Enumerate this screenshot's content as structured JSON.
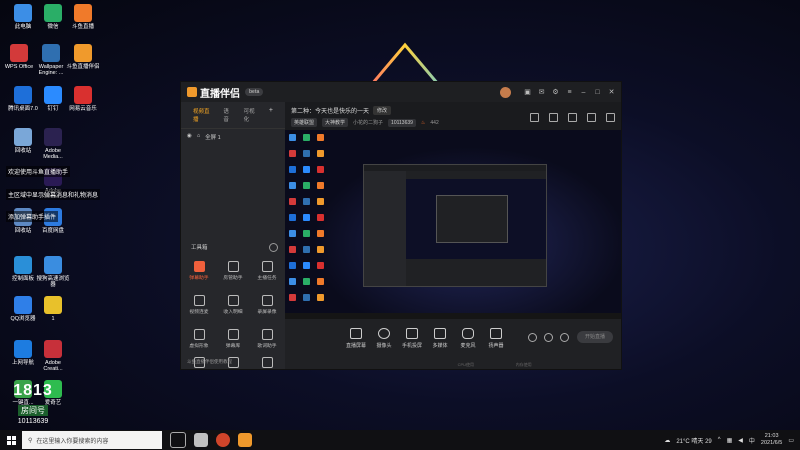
{
  "desktop": {
    "icons": [
      {
        "label": "此电脑",
        "color": "#3c8ee6"
      },
      {
        "label": "微信",
        "color": "#2aae67"
      },
      {
        "label": "斗鱼直播",
        "color": "#f07a2a"
      },
      {
        "label": "WPS Office",
        "color": "#d33a3a"
      },
      {
        "label": "Wallpaper Engine: ...",
        "color": "#2f6fb0"
      },
      {
        "label": "斗鱼直播伴侣",
        "color": "#f09a2c"
      },
      {
        "label": "腾讯桌面7.0",
        "color": "#1e6fd9"
      },
      {
        "label": "钉钉",
        "color": "#2b8bff"
      },
      {
        "label": "网易云音乐",
        "color": "#d9302f"
      },
      {
        "label": "回收站",
        "color": "#7aa7d8"
      },
      {
        "label": "Adobe Media...",
        "color": "#2b2250"
      },
      {
        "label": "Adobe Premie...",
        "color": "#2a1a55"
      },
      {
        "label": "回收站",
        "color": "#5d89c4"
      },
      {
        "label": "百度网盘",
        "color": "#2d7be0"
      },
      {
        "label": "控制面板",
        "color": "#2a8fd8"
      },
      {
        "label": "搜狗高速浏览器",
        "color": "#3a8de0"
      },
      {
        "label": "QQ浏览器",
        "color": "#2f7fe8"
      },
      {
        "label": "1",
        "color": "#e8c12b"
      },
      {
        "label": "上网导航",
        "color": "#1d7ce0"
      },
      {
        "label": "Adobe Creati...",
        "color": "#c7303a"
      },
      {
        "label": "一键直...",
        "color": "#3aa34a"
      },
      {
        "label": "爱奇艺",
        "color": "#2ebc4f"
      }
    ],
    "overlay_lines": [
      "欢迎使用斗鱼直播助手",
      "主区域中显示弹幕消息和礼物消息",
      "添加弹幕助手插件"
    ],
    "room_badge": {
      "big": "1813",
      "title": "房间号",
      "number": "10113639"
    }
  },
  "app": {
    "name": "直播伴侣",
    "version_badge": "beta",
    "titlebar_icons": [
      "skin-icon",
      "message-icon",
      "settings-icon",
      "menu-icon",
      "minimize-icon",
      "maximize-icon",
      "close-icon"
    ],
    "left_tabs": [
      {
        "label": "视频直播",
        "active": true
      },
      {
        "label": "语音",
        "active": false
      },
      {
        "label": "可视化",
        "active": false
      }
    ],
    "scene_label": "全屏 1",
    "tools_title": "工具箱",
    "tools": [
      {
        "label": "弹幕助手",
        "hot": true
      },
      {
        "label": "房管助手",
        "hot": false
      },
      {
        "label": "主播任务",
        "hot": false
      },
      {
        "label": "视频连麦",
        "hot": false
      },
      {
        "label": "收入明细",
        "hot": false
      },
      {
        "label": "录屏录像",
        "hot": false
      },
      {
        "label": "虚拟形象",
        "hot": false
      },
      {
        "label": "弹幕库",
        "hot": false
      },
      {
        "label": "歌词助手",
        "hot": false
      },
      {
        "label": "",
        "hot": false
      },
      {
        "label": "",
        "hot": false
      },
      {
        "label": "",
        "hot": false
      }
    ],
    "left_footer": "斗鱼直播伴侣使用教程",
    "stream_title": "第二种：今天也是快乐的一天",
    "edit_label": "修改",
    "category": "英雄联盟",
    "subcategory": "大神教学",
    "host_name": "小花的二狗子",
    "room_id": "10113639",
    "viewer_count": "442",
    "bottom_buttons": [
      "直播屏幕",
      "摄像头",
      "手机投屏",
      "多媒体",
      "麦克风",
      "扬声器"
    ],
    "start_live_label": "开始直播",
    "status_items": [
      "",
      "",
      "",
      "",
      "CPU使用",
      "内存使用",
      "",
      ""
    ]
  },
  "taskbar": {
    "search_placeholder": "在这里输入你要搜索的内容",
    "weather": "21°C 晴天 29",
    "ime": "中",
    "time": "21:03",
    "date": "2021/6/5"
  }
}
